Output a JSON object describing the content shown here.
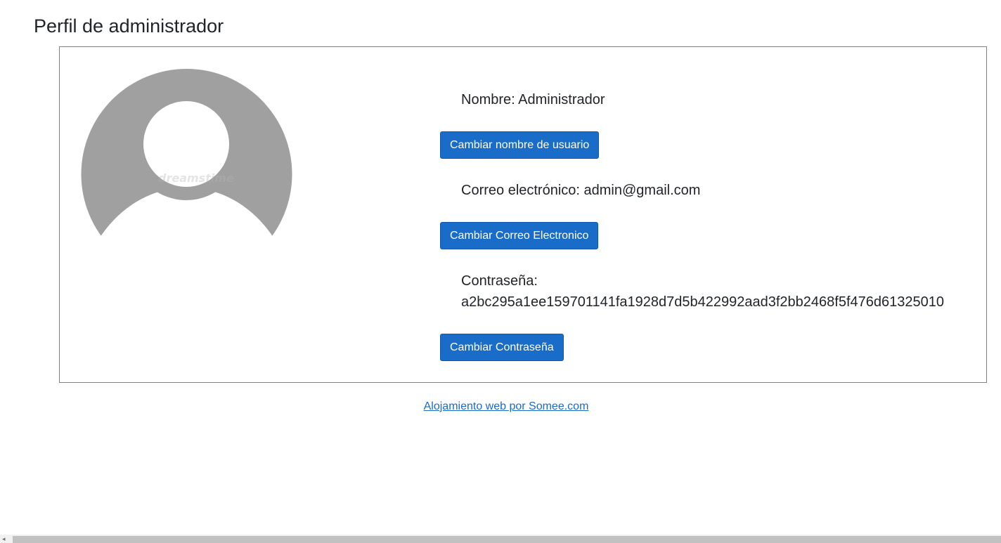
{
  "page": {
    "title": "Perfil de administrador"
  },
  "profile": {
    "avatar_icon": "user-avatar-placeholder-icon",
    "avatar_watermark": "dreamstime",
    "name_line": "Nombre: Administrador",
    "change_name_label": "Cambiar nombre de usuario",
    "email_line": "Correo electrónico: admin@gmail.com",
    "change_email_label": "Cambiar Correo Electronico",
    "password_label": "Contraseña:",
    "password_hash": "a2bc295a1ee159701141fa1928d7d5b422992aad3f2bb2468f5f476d61325010",
    "change_password_label": "Cambiar Contraseña"
  },
  "footer": {
    "link_text": "Alojamiento web por Somee.com"
  },
  "colors": {
    "button_bg": "#1a6cc9",
    "avatar_gray": "#a0a0a0",
    "link": "#1a6cc9"
  }
}
